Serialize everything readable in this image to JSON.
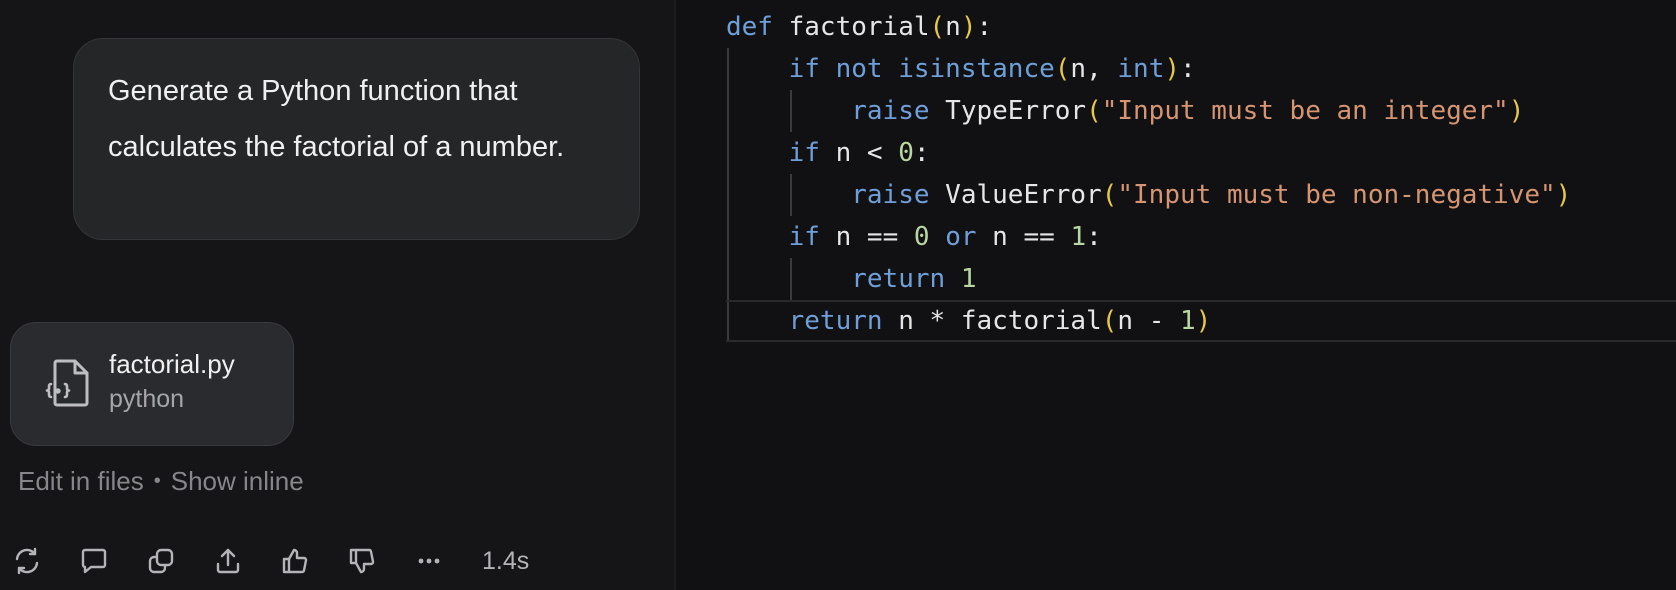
{
  "chat": {
    "user_message": "Generate a Python function that calculates the factorial of a number.",
    "file_card": {
      "name": "factorial.py",
      "language": "python"
    },
    "edit_in_files": "Edit in files",
    "separator": "•",
    "show_inline": "Show inline",
    "response_time": "1.4s",
    "actions": [
      "refresh-icon",
      "comment-icon",
      "copy-icon",
      "share-icon",
      "thumbs-up-icon",
      "thumbs-down-icon",
      "more-icon"
    ]
  },
  "code": {
    "language": "python",
    "lines": [
      "def factorial(n):",
      "    if not isinstance(n, int):",
      "        raise TypeError(\"Input must be an integer\")",
      "    if n < 0:",
      "        raise ValueError(\"Input must be non-negative\")",
      "    if n == 0 or n == 1:",
      "        return 1",
      "    return n * factorial(n - 1)"
    ]
  },
  "colors": {
    "background": "#141416",
    "bubble": "#252628",
    "keyword": "#6f9fd8",
    "string": "#d59572",
    "number": "#b9d7a2",
    "paren": "#e8c84a"
  }
}
